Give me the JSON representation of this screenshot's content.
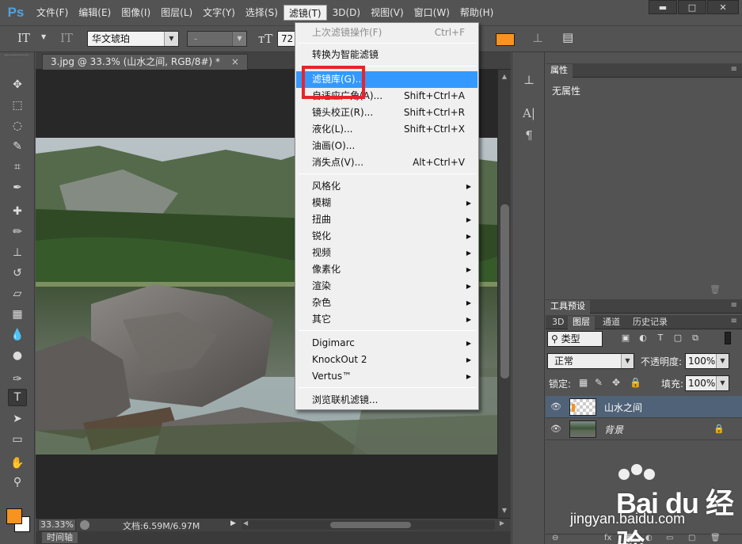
{
  "app": {
    "logo": "Ps"
  },
  "menubar": {
    "items": [
      "文件(F)",
      "编辑(E)",
      "图像(I)",
      "图层(L)",
      "文字(Y)",
      "选择(S)",
      "滤镜(T)",
      "3D(D)",
      "视图(V)",
      "窗口(W)",
      "帮助(H)"
    ],
    "active_index": 6
  },
  "window_controls": {
    "minimize": "▬",
    "restore": "□",
    "close": "✕"
  },
  "options_bar": {
    "tool_icon": "text-tool-icon",
    "font_family": "华文琥珀",
    "font_style": "-",
    "font_size": "72",
    "text_color": "#f7931e"
  },
  "document": {
    "tab_title": "3.jpg @ 33.3% (山水之间, RGB/8#) *",
    "tab_close": "×",
    "zoom": "33.33%",
    "doc_size": "文档:6.59M/6.97M"
  },
  "timeline_tab": "时间轴",
  "filter_menu": {
    "items": [
      {
        "label": "上次滤镜操作(F)",
        "shortcut": "Ctrl+F",
        "disabled": true
      },
      {
        "label": "转换为智能滤镜"
      },
      {
        "label": "滤镜库(G)...",
        "highlighted": true
      },
      {
        "label": "自适应广角(A)...",
        "shortcut": "Shift+Ctrl+A"
      },
      {
        "label": "镜头校正(R)...",
        "shortcut": "Shift+Ctrl+R"
      },
      {
        "label": "液化(L)...",
        "shortcut": "Shift+Ctrl+X"
      },
      {
        "label": "油画(O)..."
      },
      {
        "label": "消失点(V)...",
        "shortcut": "Alt+Ctrl+V"
      },
      {
        "label": "风格化",
        "submenu": true
      },
      {
        "label": "模糊",
        "submenu": true
      },
      {
        "label": "扭曲",
        "submenu": true
      },
      {
        "label": "锐化",
        "submenu": true
      },
      {
        "label": "视频",
        "submenu": true
      },
      {
        "label": "像素化",
        "submenu": true
      },
      {
        "label": "渲染",
        "submenu": true
      },
      {
        "label": "杂色",
        "submenu": true
      },
      {
        "label": "其它",
        "submenu": true
      },
      {
        "label": "Digimarc",
        "submenu": true
      },
      {
        "label": "KnockOut 2",
        "submenu": true
      },
      {
        "label": "Vertus™",
        "submenu": true
      },
      {
        "label": "浏览联机滤镜..."
      }
    ],
    "submenu_arrow": "▶"
  },
  "properties_panel": {
    "tab": "属性",
    "empty_label": "无属性"
  },
  "presets_panel": {
    "tab": "工具预设"
  },
  "layers_panel": {
    "tabs": [
      "3D",
      "图层",
      "通道",
      "历史记录"
    ],
    "active_tab": "图层",
    "kind_filter": "类型",
    "blend_mode": "正常",
    "opacity_label": "不透明度:",
    "opacity": "100%",
    "lock_label": "锁定:",
    "fill_label": "填充:",
    "fill": "100%",
    "layers": [
      {
        "name": "山水之间",
        "type": "text",
        "selected": true
      },
      {
        "name": "背景",
        "type": "image",
        "locked": true
      }
    ]
  },
  "watermark": {
    "brand": "Bai du 经验",
    "url": "jingyan.baidu.com"
  }
}
